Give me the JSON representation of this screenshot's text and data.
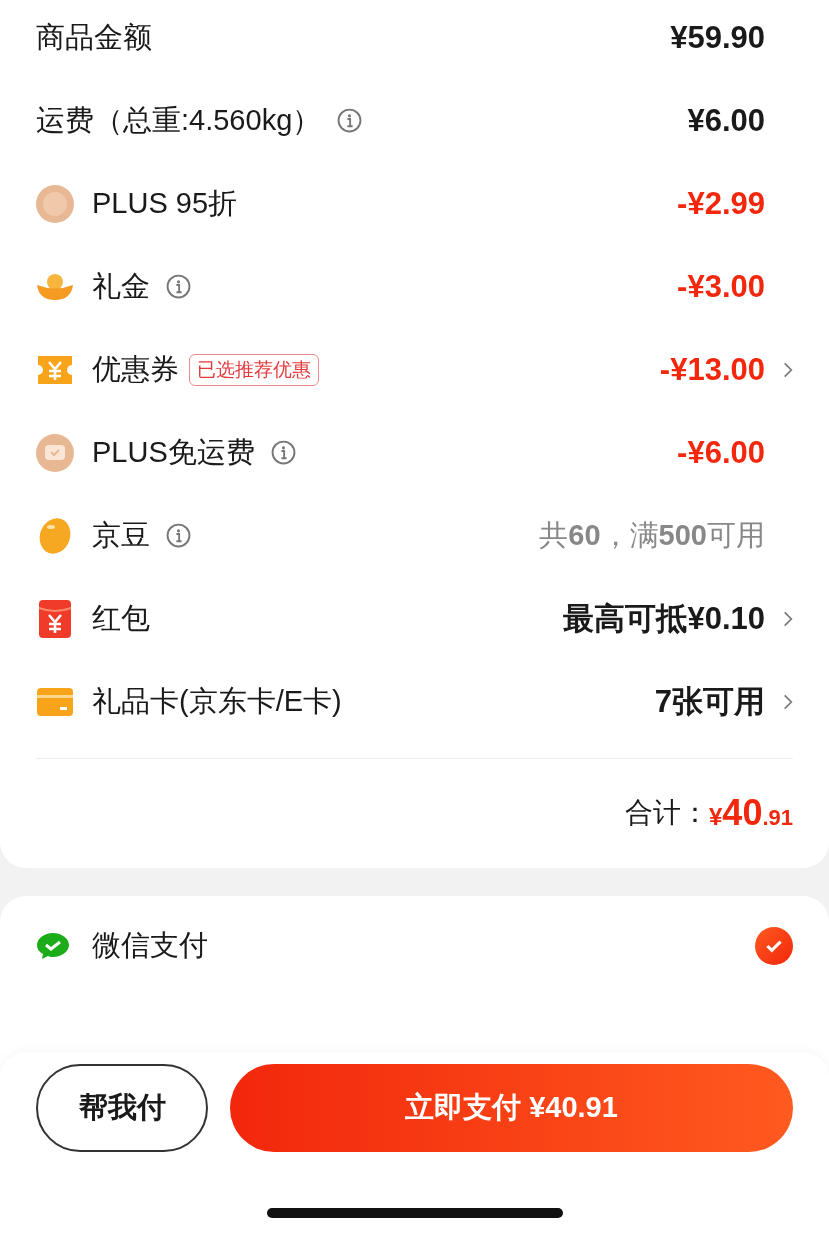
{
  "summary": [
    {
      "label": "商品金额",
      "info": false,
      "value": "¥59.90",
      "discount": false,
      "disabled": false,
      "chevron": false
    },
    {
      "label": "运费（总重:4.560kg）",
      "info": true,
      "value": "¥6.00",
      "discount": false,
      "disabled": false,
      "chevron": false
    },
    {
      "label": "PLUS 95折",
      "info": false,
      "value": "-¥2.99",
      "discount": true,
      "disabled": false,
      "chevron": false
    },
    {
      "label": "礼金",
      "info": true,
      "value": "-¥3.00",
      "discount": true,
      "disabled": false,
      "chevron": false
    },
    {
      "label": "优惠券",
      "info": false,
      "tag": "已选推荐优惠",
      "value": "-¥13.00",
      "discount": true,
      "disabled": false,
      "chevron": true
    },
    {
      "label": "PLUS免运费",
      "info": true,
      "value": "-¥6.00",
      "discount": true,
      "disabled": false,
      "chevron": false
    },
    {
      "label": "京豆",
      "info": true,
      "value": "共**60**，满**500**可用",
      "discount": false,
      "disabled": true,
      "chevron": false
    },
    {
      "label": "红包",
      "info": false,
      "value": "最高可抵¥0.10",
      "discount": false,
      "disabled": false,
      "chevron": true
    },
    {
      "label": "礼品卡(京东卡/E卡)",
      "info": false,
      "value": "7张可用",
      "discount": false,
      "disabled": false,
      "chevron": true
    }
  ],
  "total": {
    "label": "合计：",
    "currency": "¥",
    "integer": "40",
    "decimals": ".91"
  },
  "payment_methods": [
    {
      "name": "微信支付",
      "selected": true
    }
  ],
  "buttons": {
    "secondary": "帮我付",
    "primary": "立即支付 ¥40.91"
  }
}
